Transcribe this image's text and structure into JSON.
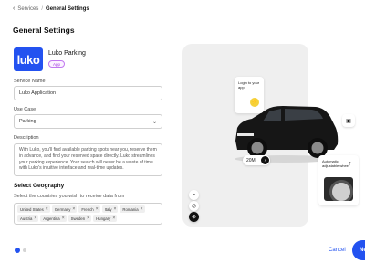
{
  "breadcrumb": {
    "back_icon": "chevron-left-icon",
    "parent": "Services",
    "separator": "/",
    "current": "General Settings"
  },
  "page_title": "General Settings",
  "app": {
    "logo_text": "luko",
    "logo_color": "#2352f0",
    "name": "Luko Parking",
    "badge": "App"
  },
  "form": {
    "service_name": {
      "label": "Service Name",
      "value": "Luko Application"
    },
    "use_case": {
      "label": "Use Case",
      "value": "Parking",
      "chevron_icon": "chevron-down-icon"
    },
    "description": {
      "label": "Description",
      "value": "With Luko, you'll find available parking spots near you, reserve them in advance, and find your reserved space directly. Luko streamlines your parking experience. Your search will never be a waste of time with Luko's intuitive interface and real-time updates."
    }
  },
  "geography": {
    "title": "Select Geography",
    "subtitle": "Select the countries you wish to receive data from",
    "countries": [
      "United States",
      "Germany",
      "French",
      "Italy",
      "Romania",
      "Austria",
      "Argentina",
      "Sweden",
      "Hungary"
    ],
    "remove_icon": "close-icon"
  },
  "footer": {
    "cancel": "Cancel",
    "next": "Ne",
    "primary_color": "#2352f0"
  },
  "preview": {
    "login_card": "Login to your app",
    "wheel_card": "Automatic adjustable wheel",
    "zoom_value": "20M",
    "zoom_go_icon": "arrow-right-icon"
  }
}
